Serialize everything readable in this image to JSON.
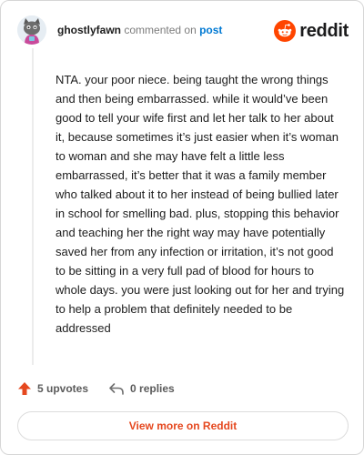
{
  "comment": {
    "author": "ghostlyfawn",
    "verb": "commented on",
    "target": "post",
    "text": "NTA. your poor niece. being taught the wrong things and then being embarrassed. while it would’ve been good to tell your wife first and let her talk to her about it, because sometimes it’s just easier when it’s woman to woman and she may have felt a little less embarrassed, it’s better that it was a family member who talked about it to her instead of being bullied later in school for smelling bad. plus, stopping this behavior and teaching her the right way may have potentially saved her from any infection or irritation, it’s not good to be sitting in a very full pad of blood for hours to whole days. you were just looking out for her and trying to help a problem that definitely needed to be addressed"
  },
  "brand": {
    "name": "reddit",
    "icon": "reddit-snoo-icon",
    "color": "#ff4500"
  },
  "actions": {
    "upvotes": "5 upvotes",
    "replies": "0 replies",
    "upvote_icon": "upvote-arrow-icon",
    "reply_icon": "reply-arrow-icon",
    "upvote_color": "#e5481f"
  },
  "footer": {
    "view_more_label": "View more on Reddit"
  }
}
